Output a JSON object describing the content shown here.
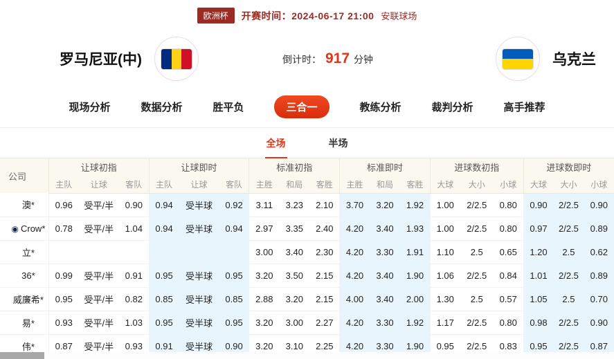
{
  "colors": {
    "dark_red": "#9c2b24",
    "accent_red": "#e23517",
    "live_blue": "#0066cc",
    "live_bg": "#e9f5fc",
    "table_header_bg": "#fbf8ef"
  },
  "match_header": {
    "league_badge": "欧洲杯",
    "kickoff": "开赛时间：2024-06-17 21:00",
    "venue": "安联球场"
  },
  "teams": {
    "home_name": "罗马尼亚(中)",
    "home_flag": "romania-flag",
    "away_name": "乌克兰",
    "away_flag": "ukraine-flag",
    "countdown_label": "倒计时：",
    "countdown_value": "917",
    "countdown_unit": "分钟"
  },
  "nav_tabs": [
    {
      "label": "现场分析",
      "active": false
    },
    {
      "label": "数据分析",
      "active": false
    },
    {
      "label": "胜平负",
      "active": false
    },
    {
      "label": "三合一",
      "active": true
    },
    {
      "label": "教练分析",
      "active": false
    },
    {
      "label": "裁判分析",
      "active": false
    },
    {
      "label": "高手推荐",
      "active": false
    }
  ],
  "sub_tabs": [
    {
      "label": "全场",
      "active": true
    },
    {
      "label": "半场",
      "active": false
    }
  ],
  "table": {
    "company_header": "公司",
    "groups": [
      {
        "label": "让球初指",
        "cols": [
          "主队",
          "让球",
          "客队"
        ],
        "live": false
      },
      {
        "label": "让球即时",
        "cols": [
          "主队",
          "让球",
          "客队"
        ],
        "live": true
      },
      {
        "label": "标准初指",
        "cols": [
          "主胜",
          "和局",
          "客胜"
        ],
        "live": false
      },
      {
        "label": "标准即时",
        "cols": [
          "主胜",
          "和局",
          "客胜"
        ],
        "live": true
      },
      {
        "label": "进球数初指",
        "cols": [
          "大球",
          "大小",
          "小球"
        ],
        "live": false
      },
      {
        "label": "进球数即时",
        "cols": [
          "大球",
          "大小",
          "小球"
        ],
        "live": true
      }
    ],
    "rows": [
      {
        "company": "澳*",
        "icon": false,
        "values": [
          "0.96",
          "受平/半",
          "0.90",
          "0.94",
          "受半球",
          "0.92",
          "3.11",
          "3.23",
          "2.10",
          "3.70",
          "3.20",
          "1.92",
          "1.00",
          "2/2.5",
          "0.80",
          "0.90",
          "2/2.5",
          "0.90"
        ]
      },
      {
        "company": "Crow*",
        "icon": true,
        "values": [
          "0.78",
          "受平/半",
          "1.04",
          "0.94",
          "受半球",
          "0.94",
          "2.97",
          "3.35",
          "2.40",
          "4.20",
          "3.40",
          "1.93",
          "1.00",
          "2/2.5",
          "0.80",
          "0.97",
          "2/2.5",
          "0.89"
        ]
      },
      {
        "company": "立*",
        "icon": false,
        "values": [
          "",
          "",
          "",
          "",
          "",
          "",
          "3.00",
          "3.40",
          "2.30",
          "4.20",
          "3.30",
          "1.91",
          "1.10",
          "2.5",
          "0.65",
          "1.20",
          "2.5",
          "0.62"
        ]
      },
      {
        "company": "36*",
        "icon": false,
        "values": [
          "0.99",
          "受平/半",
          "0.91",
          "0.95",
          "受半球",
          "0.95",
          "3.20",
          "3.50",
          "2.15",
          "4.20",
          "3.40",
          "1.90",
          "1.06",
          "2/2.5",
          "0.84",
          "1.01",
          "2/2.5",
          "0.89"
        ]
      },
      {
        "company": "威廉希*",
        "icon": false,
        "values": [
          "0.95",
          "受平/半",
          "0.82",
          "0.85",
          "受半球",
          "0.85",
          "2.88",
          "3.20",
          "2.15",
          "4.00",
          "3.40",
          "2.00",
          "1.30",
          "2.5",
          "0.57",
          "1.05",
          "2.5",
          "0.70"
        ]
      },
      {
        "company": "易*",
        "icon": false,
        "values": [
          "0.93",
          "受平/半",
          "1.03",
          "0.95",
          "受半球",
          "0.95",
          "3.20",
          "3.00",
          "2.27",
          "4.20",
          "3.30",
          "1.92",
          "1.17",
          "2/2.5",
          "0.80",
          "0.98",
          "2/2.5",
          "0.90"
        ]
      },
      {
        "company": "伟*",
        "icon": false,
        "values": [
          "0.87",
          "受平/半",
          "0.93",
          "0.91",
          "受半球",
          "0.90",
          "3.20",
          "3.10",
          "2.25",
          "4.20",
          "3.30",
          "1.90",
          "0.95",
          "2/2.5",
          "0.83",
          "0.95",
          "2/2.5",
          "0.87"
        ]
      }
    ]
  }
}
